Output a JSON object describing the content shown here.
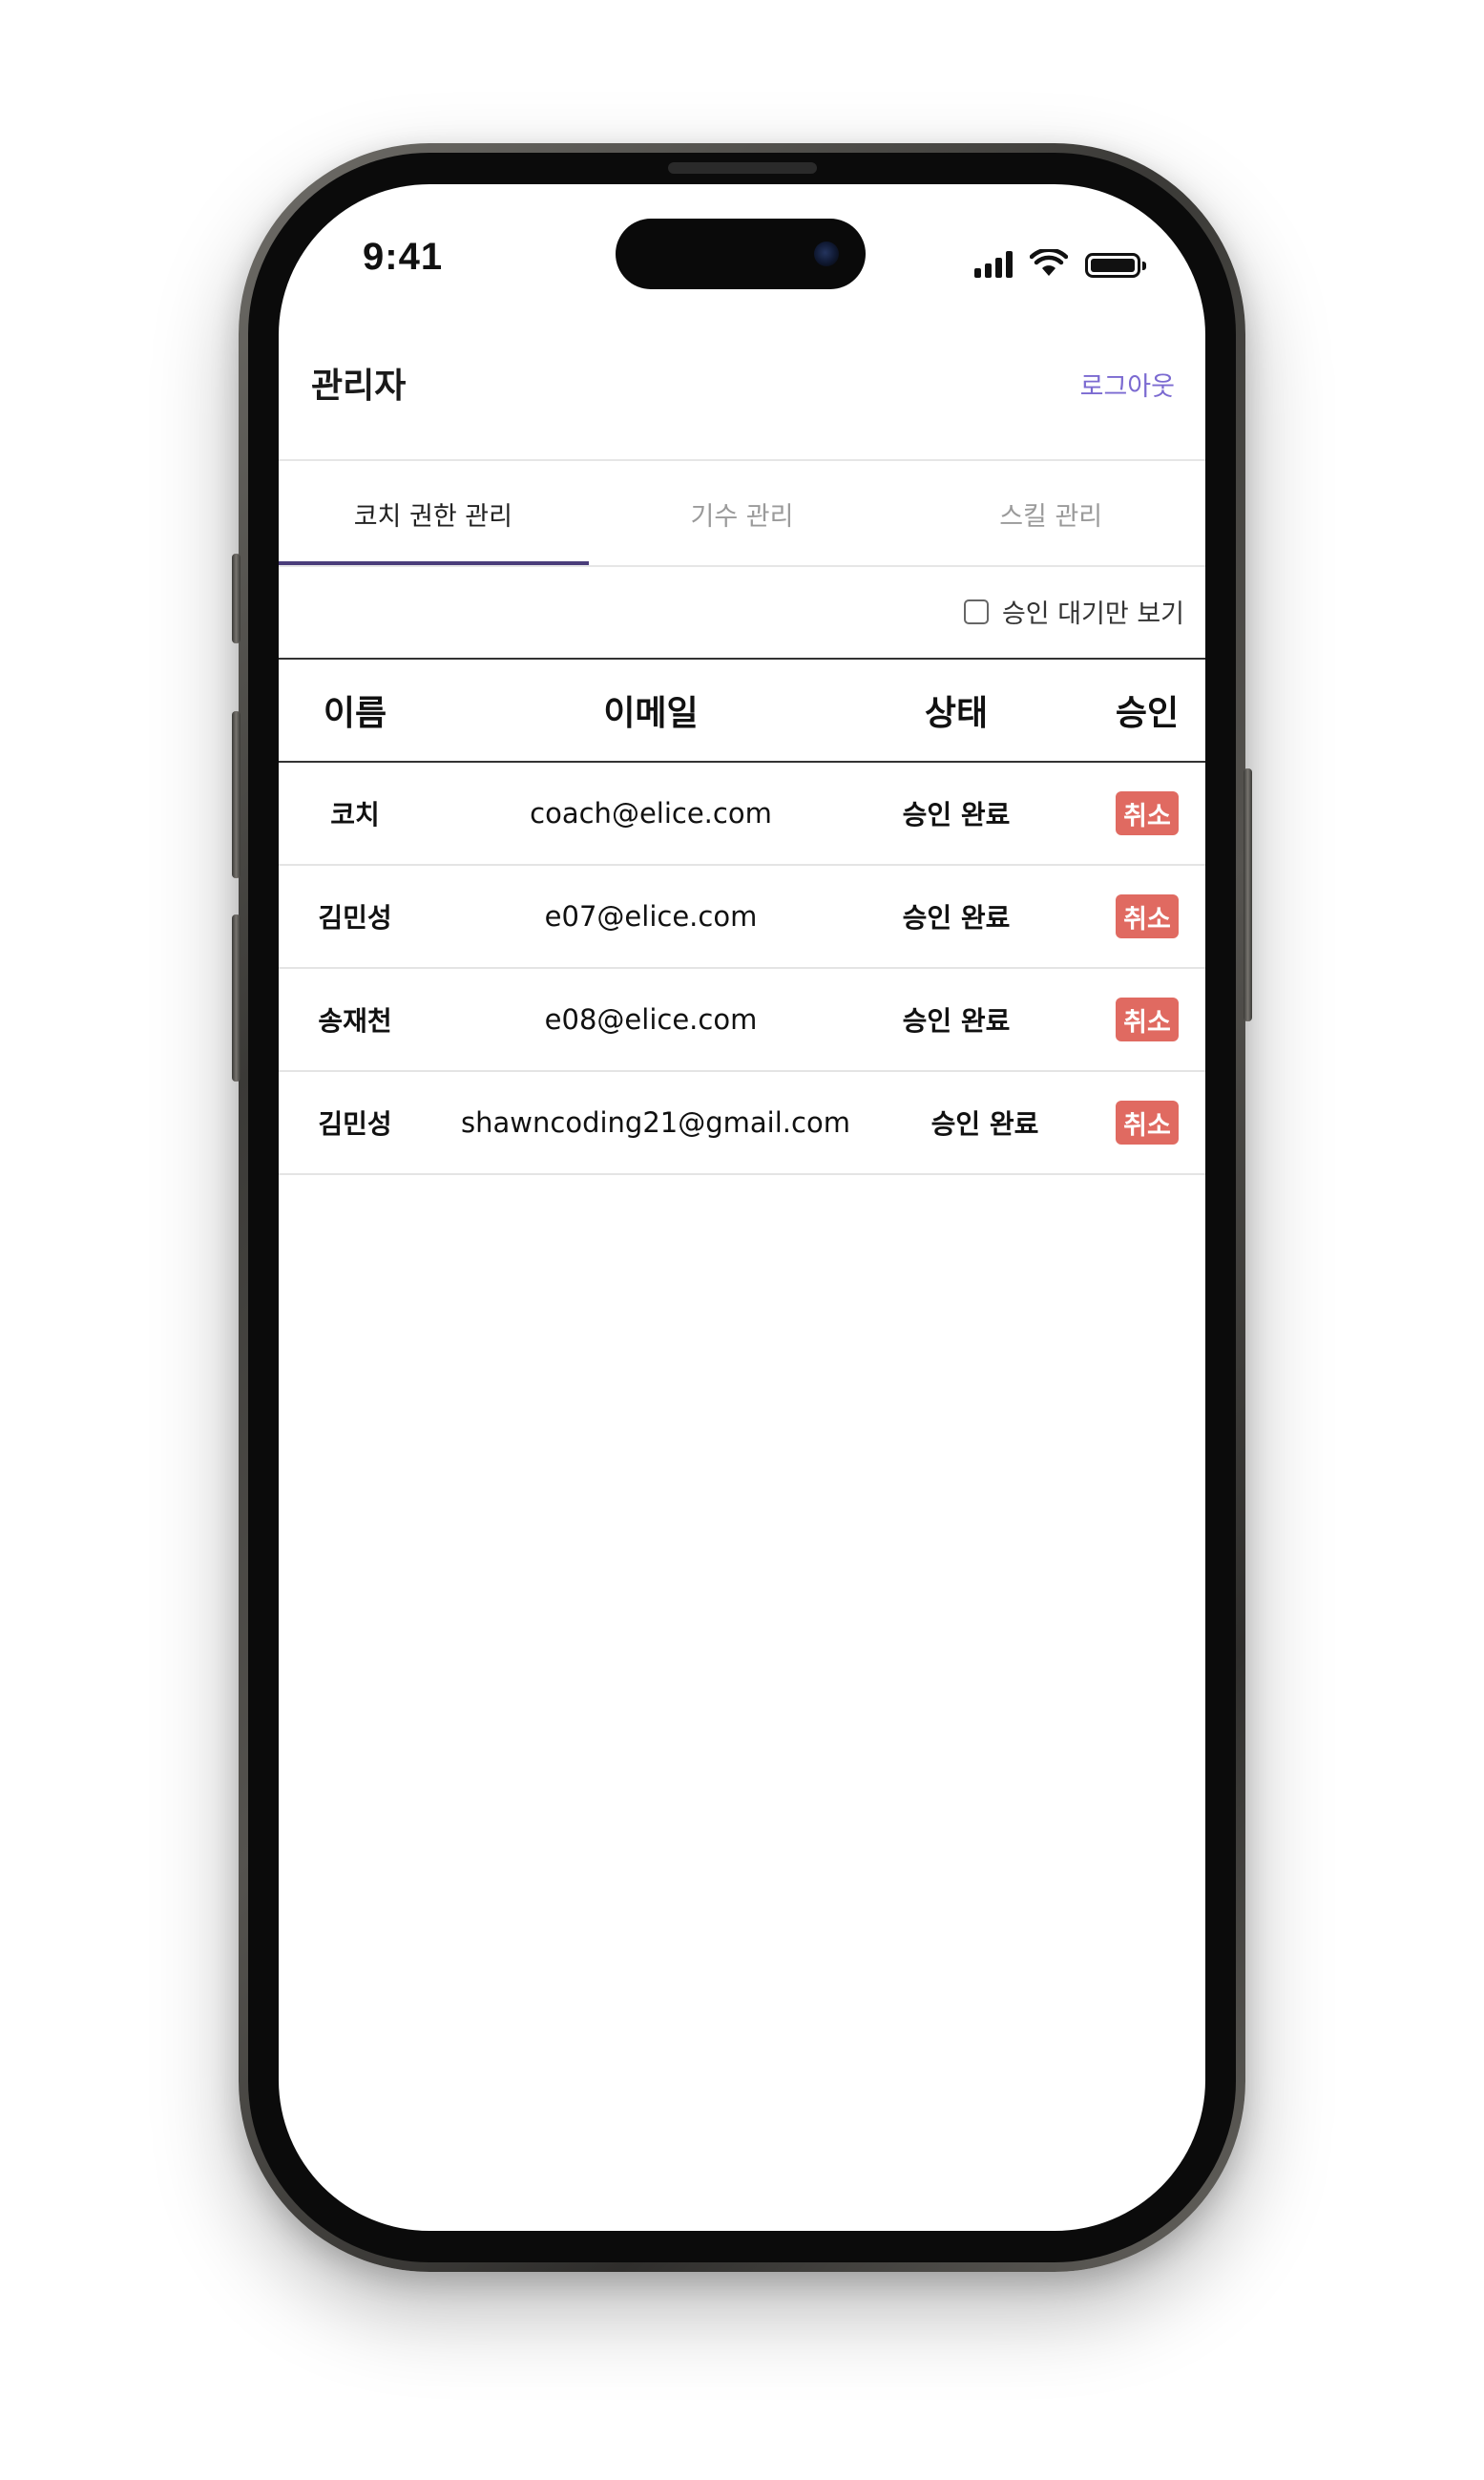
{
  "status_bar": {
    "time": "9:41"
  },
  "header": {
    "title": "관리자",
    "logout_label": "로그아웃"
  },
  "tabs": [
    {
      "label": "코치 권한 관리",
      "active": true
    },
    {
      "label": "기수 관리",
      "active": false
    },
    {
      "label": "스킬 관리",
      "active": false
    }
  ],
  "filter": {
    "label": "승인 대기만 보기",
    "checked": false
  },
  "table": {
    "columns": [
      "이름",
      "이메일",
      "상태",
      "승인"
    ],
    "rows": [
      {
        "name": "코치",
        "email": "coach@elice.com",
        "status": "승인 완료",
        "action": "취소"
      },
      {
        "name": "김민성",
        "email": "e07@elice.com",
        "status": "승인 완료",
        "action": "취소"
      },
      {
        "name": "송재천",
        "email": "e08@elice.com",
        "status": "승인 완료",
        "action": "취소"
      },
      {
        "name": "김민성",
        "email": "shawncoding21@gmail.com",
        "status": "승인 완료",
        "action": "취소"
      }
    ]
  },
  "colors": {
    "accent": "#7b6ad1",
    "tab_underline": "#4a3d7a",
    "cancel_button": "#e06a61"
  }
}
